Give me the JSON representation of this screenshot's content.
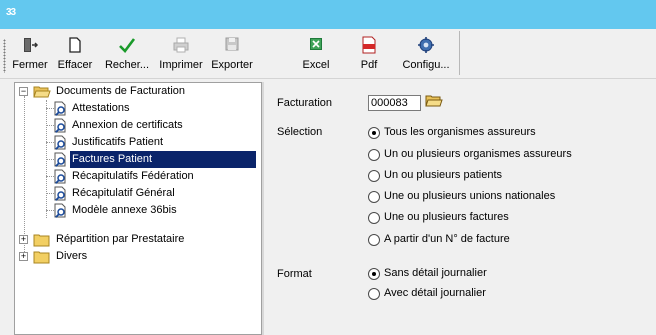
{
  "window": {
    "app_icon_text": "33",
    "titlebar_color": "#63c8ef"
  },
  "toolbar": {
    "buttons": [
      {
        "label": "Fermer",
        "icon": "exit-door-icon"
      },
      {
        "label": "Effacer",
        "icon": "blank-page-icon"
      },
      {
        "label": "Recher...",
        "icon": "checkmark-icon"
      },
      {
        "label": "Imprimer",
        "icon": "printer-icon"
      },
      {
        "label": "Exporter",
        "icon": "floppy-disk-icon"
      },
      {
        "label": "Excel",
        "icon": "excel-icon"
      },
      {
        "label": "Pdf",
        "icon": "pdf-icon"
      },
      {
        "label": "Configu...",
        "icon": "gear-icon"
      }
    ]
  },
  "tree": {
    "root": {
      "label": "Documents de Facturation",
      "icon": "open-folder-icon",
      "expander": "−"
    },
    "children": [
      {
        "label": "Attestations",
        "icon": "document-search-icon"
      },
      {
        "label": "Annexion de certificats",
        "icon": "document-search-icon"
      },
      {
        "label": "Justificatifs Patient",
        "icon": "document-search-icon"
      },
      {
        "label": "Factures Patient",
        "icon": "document-search-icon",
        "selected": true
      },
      {
        "label": "Récapitulatifs Fédération",
        "icon": "document-search-icon"
      },
      {
        "label": "Récapitulatif Général",
        "icon": "document-search-icon"
      },
      {
        "label": "Modèle annexe 36bis",
        "icon": "document-search-icon"
      }
    ],
    "siblings": [
      {
        "label": "Répartition par Prestataire",
        "icon": "folder-icon",
        "expander": "+"
      },
      {
        "label": "Divers",
        "icon": "folder-icon",
        "expander": "+"
      }
    ],
    "selected_color": "#0a246a"
  },
  "form": {
    "facturation": {
      "label": "Facturation",
      "value": "000083",
      "button_icon": "open-folder-icon"
    },
    "selection": {
      "label": "Sélection",
      "options": [
        {
          "label": "Tous les organismes assureurs",
          "checked": true
        },
        {
          "label": "Un ou plusieurs organismes assureurs",
          "checked": false
        },
        {
          "label": "Un ou plusieurs patients",
          "checked": false
        },
        {
          "label": "Une ou plusieurs unions nationales",
          "checked": false
        },
        {
          "label": "Une ou plusieurs factures",
          "checked": false
        },
        {
          "label": "A partir d'un N° de facture",
          "checked": false
        }
      ]
    },
    "format": {
      "label": "Format",
      "options": [
        {
          "label": "Sans détail journalier",
          "checked": true
        },
        {
          "label": "Avec détail journalier",
          "checked": false
        }
      ]
    }
  }
}
